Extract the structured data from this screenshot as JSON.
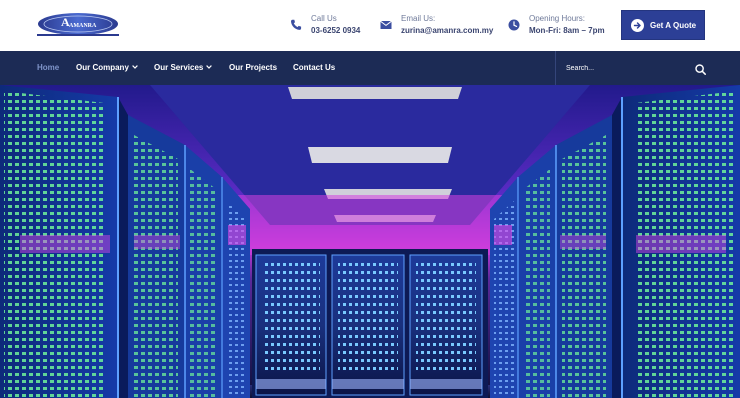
{
  "header": {
    "logo_text": "AMANRA",
    "phone": {
      "label": "Call Us",
      "value": "03-6252 0934",
      "icon": "phone-icon"
    },
    "email": {
      "label": "Email Us:",
      "value": "zurina@amanra.com.my",
      "icon": "mail-icon"
    },
    "hours": {
      "label": "Opening Hours:",
      "value": "Mon-Fri: 8am – 7pm",
      "icon": "clock-icon"
    },
    "quote_button": {
      "label": "Get A Quote",
      "icon": "arrow-right-circle-icon"
    }
  },
  "nav": {
    "items": [
      {
        "label": "Home",
        "active": true,
        "dropdown": false
      },
      {
        "label": "Our Company",
        "active": false,
        "dropdown": true
      },
      {
        "label": "Our Services",
        "active": false,
        "dropdown": true
      },
      {
        "label": "Our Projects",
        "active": false,
        "dropdown": false
      },
      {
        "label": "Contact Us",
        "active": false,
        "dropdown": false
      }
    ],
    "search": {
      "placeholder": "Search...",
      "icon": "search-icon"
    }
  },
  "hero": {
    "image": "server-room-photo"
  },
  "colors": {
    "brand_blue": "#2c3f96",
    "nav_bg": "#1c2b55",
    "nav_active": "#7f94c9",
    "hero_magenta": "#c23ad6",
    "hero_blue": "#1b4fd6"
  }
}
